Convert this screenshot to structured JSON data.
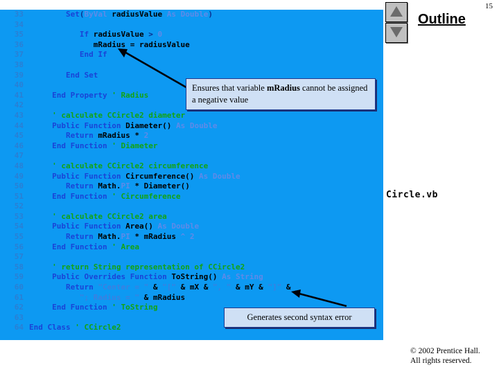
{
  "slide": {
    "page_number": "15",
    "title": "Outline",
    "file_label": "Circle.vb",
    "copyright_line1": "© 2002 Prentice Hall.",
    "copyright_line2": "All rights reserved.",
    "accent_color": "#0d99f2",
    "callout_fill": "#cfe0f5",
    "callout_border": "#203a8f"
  },
  "scroll": {
    "up_icon": "triangle-up-icon",
    "down_icon": "triangle-down-icon"
  },
  "callouts": [
    {
      "id": "callout-mradius",
      "text_before": "Ensures that variable ",
      "emphasis": "mRadius",
      "text_after": " cannot be assigned a negative value"
    },
    {
      "id": "callout-syntax",
      "text": "Generates second syntax error"
    }
  ],
  "code": {
    "language": "Visual Basic .NET",
    "lines": [
      {
        "n": "33",
        "tokens": [
          {
            "t": "        ",
            "c": "id"
          },
          {
            "t": "Set",
            "c": "kw"
          },
          {
            "t": "(",
            "c": "pl"
          },
          {
            "t": "ByVal ",
            "c": "kwd"
          },
          {
            "t": "radiusValue",
            "c": "id"
          },
          {
            "t": " As Double",
            "c": "kwd"
          },
          {
            "t": ")",
            "c": "pl"
          }
        ]
      },
      {
        "n": "34",
        "tokens": []
      },
      {
        "n": "35",
        "tokens": [
          {
            "t": "           ",
            "c": "id"
          },
          {
            "t": "If ",
            "c": "kw"
          },
          {
            "t": "radiusValue ",
            "c": "id"
          },
          {
            "t": "> ",
            "c": "pl"
          },
          {
            "t": "0",
            "c": "kwd"
          }
        ]
      },
      {
        "n": "36",
        "tokens": [
          {
            "t": "              ",
            "c": "id"
          },
          {
            "t": "mRadius = radiusValue",
            "c": "id"
          }
        ]
      },
      {
        "n": "37",
        "tokens": [
          {
            "t": "           ",
            "c": "id"
          },
          {
            "t": "End If",
            "c": "kw"
          }
        ]
      },
      {
        "n": "38",
        "tokens": []
      },
      {
        "n": "39",
        "tokens": [
          {
            "t": "        ",
            "c": "id"
          },
          {
            "t": "End Set",
            "c": "kw"
          }
        ]
      },
      {
        "n": "40",
        "tokens": []
      },
      {
        "n": "41",
        "tokens": [
          {
            "t": "     ",
            "c": "id"
          },
          {
            "t": "End Property ",
            "c": "kw"
          },
          {
            "t": "' Radius",
            "c": "cm"
          }
        ]
      },
      {
        "n": "42",
        "tokens": []
      },
      {
        "n": "43",
        "tokens": [
          {
            "t": "     ",
            "c": "id"
          },
          {
            "t": "' calculate CCircle2 diameter",
            "c": "cm"
          }
        ]
      },
      {
        "n": "44",
        "tokens": [
          {
            "t": "     ",
            "c": "id"
          },
          {
            "t": "Public Function ",
            "c": "kw"
          },
          {
            "t": "Diameter()",
            "c": "id"
          },
          {
            "t": " As Double",
            "c": "kwd"
          }
        ]
      },
      {
        "n": "45",
        "tokens": [
          {
            "t": "        ",
            "c": "id"
          },
          {
            "t": "Return ",
            "c": "kw"
          },
          {
            "t": "mRadius * ",
            "c": "id"
          },
          {
            "t": "2",
            "c": "kwd"
          }
        ]
      },
      {
        "n": "46",
        "tokens": [
          {
            "t": "     ",
            "c": "id"
          },
          {
            "t": "End Function ",
            "c": "kw"
          },
          {
            "t": "' Diameter",
            "c": "cm"
          }
        ]
      },
      {
        "n": "47",
        "tokens": []
      },
      {
        "n": "48",
        "tokens": [
          {
            "t": "     ",
            "c": "id"
          },
          {
            "t": "' calculate CCircle2 circumference",
            "c": "cm"
          }
        ]
      },
      {
        "n": "49",
        "tokens": [
          {
            "t": "     ",
            "c": "id"
          },
          {
            "t": "Public Function ",
            "c": "kw"
          },
          {
            "t": "Circumference()",
            "c": "id"
          },
          {
            "t": " As Double",
            "c": "kwd"
          }
        ]
      },
      {
        "n": "50",
        "tokens": [
          {
            "t": "        ",
            "c": "id"
          },
          {
            "t": "Return ",
            "c": "kw"
          },
          {
            "t": "Math.",
            "c": "id"
          },
          {
            "t": "PI",
            "c": "kwd"
          },
          {
            "t": " * Diameter()",
            "c": "id"
          }
        ]
      },
      {
        "n": "51",
        "tokens": [
          {
            "t": "     ",
            "c": "id"
          },
          {
            "t": "End Function ",
            "c": "kw"
          },
          {
            "t": "' Circumference",
            "c": "cm"
          }
        ]
      },
      {
        "n": "52",
        "tokens": []
      },
      {
        "n": "53",
        "tokens": [
          {
            "t": "     ",
            "c": "id"
          },
          {
            "t": "' calculate CCircle2 area",
            "c": "cm"
          }
        ]
      },
      {
        "n": "54",
        "tokens": [
          {
            "t": "     ",
            "c": "id"
          },
          {
            "t": "Public Function ",
            "c": "kw"
          },
          {
            "t": "Area()",
            "c": "id"
          },
          {
            "t": " As Double",
            "c": "kwd"
          }
        ]
      },
      {
        "n": "55",
        "tokens": [
          {
            "t": "        ",
            "c": "id"
          },
          {
            "t": "Return ",
            "c": "kw"
          },
          {
            "t": "Math.",
            "c": "id"
          },
          {
            "t": "PI",
            "c": "kwd"
          },
          {
            "t": " * mRadius ",
            "c": "id"
          },
          {
            "t": "^ 2",
            "c": "kwd"
          }
        ]
      },
      {
        "n": "56",
        "tokens": [
          {
            "t": "     ",
            "c": "id"
          },
          {
            "t": "End Function ",
            "c": "kw"
          },
          {
            "t": "' Area",
            "c": "cm"
          }
        ]
      },
      {
        "n": "57",
        "tokens": []
      },
      {
        "n": "58",
        "tokens": [
          {
            "t": "     ",
            "c": "id"
          },
          {
            "t": "' return String representation of CCircle2",
            "c": "cm"
          }
        ]
      },
      {
        "n": "59",
        "tokens": [
          {
            "t": "     ",
            "c": "id"
          },
          {
            "t": "Public Overrides Function ",
            "c": "kw"
          },
          {
            "t": "ToString()",
            "c": "id"
          },
          {
            "t": " As String",
            "c": "kwd"
          }
        ]
      },
      {
        "n": "60",
        "tokens": [
          {
            "t": "        ",
            "c": "id"
          },
          {
            "t": "Return ",
            "c": "kw"
          },
          {
            "t": "\"Center = \"",
            "c": "str"
          },
          {
            "t": " & ",
            "c": "id"
          },
          {
            "t": "\"[\"",
            "c": "str"
          },
          {
            "t": " & mX & ",
            "c": "id"
          },
          {
            "t": "\", \"",
            "c": "str"
          },
          {
            "t": " & mY & ",
            "c": "id"
          },
          {
            "t": "\"]\"",
            "c": "str"
          },
          {
            "t": " & _",
            "c": "id"
          }
        ]
      },
      {
        "n": "61",
        "tokens": [
          {
            "t": "           ",
            "c": "id"
          },
          {
            "t": "\"; Radius = \"",
            "c": "str"
          },
          {
            "t": " & mRadius",
            "c": "id"
          }
        ]
      },
      {
        "n": "62",
        "tokens": [
          {
            "t": "     ",
            "c": "id"
          },
          {
            "t": "End Function ",
            "c": "kw"
          },
          {
            "t": "' ToString",
            "c": "cm"
          }
        ]
      },
      {
        "n": "63",
        "tokens": []
      },
      {
        "n": "64",
        "tokens": [
          {
            "t": "",
            "c": "id"
          },
          {
            "t": "End Class ",
            "c": "kw"
          },
          {
            "t": "' CCircle2",
            "c": "cm"
          }
        ]
      }
    ]
  }
}
